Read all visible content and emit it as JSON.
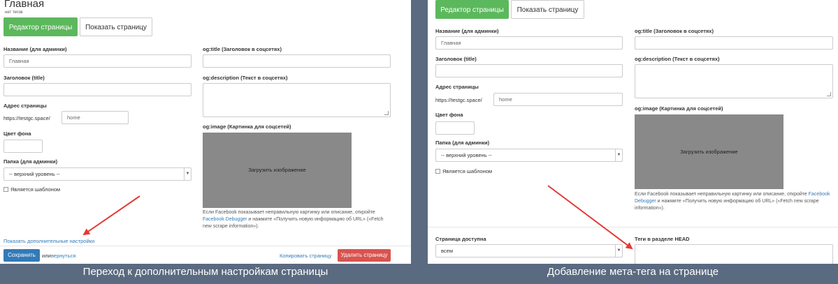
{
  "left": {
    "page_title": "Главная",
    "no_tags": "нет тегов",
    "tabs": {
      "editor": "Редактор страницы",
      "show": "Показать страницу"
    },
    "fields": {
      "admin_name_label": "Название (для админки)",
      "admin_name_value": "Главная",
      "title_label": "Заголовок (title)",
      "address_label": "Адрес страницы",
      "address_prefix": "https://testgc.space/",
      "address_value": "home",
      "bg_color_label": "Цвет фона",
      "folder_label": "Папка (для админки)",
      "folder_value": "-- верхний уровень --",
      "template_label": "Является шаблоном",
      "og_title_label": "og:title (Заголовок в соцсетях)",
      "og_description_label": "og:description (Текст в соцсетях)",
      "og_image_label": "og:image (Картинка для соцсетей)",
      "upload_label": "Загрузить изображение"
    },
    "fb_note": {
      "before": "Если Facebook показывает неправильную картинку или описание, откройте ",
      "link": "Facebook Debugger",
      "after": " и нажмите «Получить новую информацию об URL» («Fetch new scrape information»)."
    },
    "more_settings_link": "Показать дополнительные настройки",
    "save_button": "Сохранить",
    "or_text": "или",
    "back_link": "вернуться",
    "copy_link": "Копировать страницу",
    "delete_button": "Удалить страницу"
  },
  "right": {
    "tabs": {
      "editor": "Редактор страницы",
      "show": "Показать страницу"
    },
    "fields": {
      "admin_name_label": "Название (для админки)",
      "admin_name_value": "Главная",
      "title_label": "Заголовок (title)",
      "address_label": "Адрес страницы",
      "address_prefix": "https://testgc.space/",
      "address_value": "home",
      "bg_color_label": "Цвет фона",
      "folder_label": "Папка (для админки)",
      "folder_value": "-- верхний уровень --",
      "template_label": "Является шаблоном",
      "og_title_label": "og:title (Заголовок в соцсетях)",
      "og_description_label": "og:description (Текст в соцсетях)",
      "og_image_label": "og:image (Картинка для соцсетей)",
      "upload_label": "Загрузить изображение"
    },
    "fb_note": {
      "before": "Если Facebook показывает неправильную картинку или описание, откройте ",
      "link": "Facebook Debugger",
      "after": " и нажмите «Получить новую информацию об URL» («Fetch new scrape information»)."
    },
    "access_label": "Страница доступна",
    "access_value": "всем",
    "head_tags_label": "Теги в разделе HEAD"
  },
  "captions": {
    "left": "Переход к дополнительным настройкам страницы",
    "right": "Добавление мета-тега на странице"
  },
  "colors": {
    "background": "#5a6a80",
    "active_tab": "#5cb85c",
    "primary": "#337ab7",
    "danger": "#d9534f",
    "arrow": "#e53935",
    "upload_box": "#898989"
  },
  "icons": [
    "chevron-down-icon",
    "checkbox-icon",
    "resize-handle-icon",
    "arrow-pointer-icon"
  ]
}
